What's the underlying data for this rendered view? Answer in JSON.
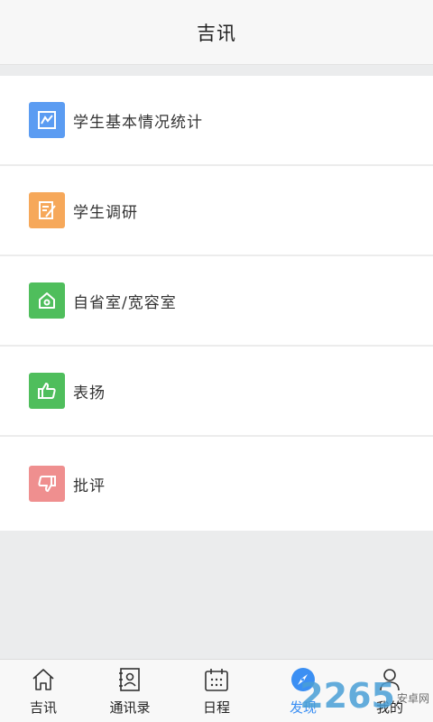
{
  "header": {
    "title": "吉讯"
  },
  "menu": {
    "items": [
      {
        "label": "学生基本情况统计",
        "icon": "chart-icon",
        "color": "#5b9cf2"
      },
      {
        "label": "学生调研",
        "icon": "survey-edit-icon",
        "color": "#f6a85a"
      },
      {
        "label": "自省室/宽容室",
        "icon": "house-icon",
        "color": "#4fbe5c"
      },
      {
        "label": "表扬",
        "icon": "thumbs-up-icon",
        "color": "#4fbe5c"
      },
      {
        "label": "批评",
        "icon": "thumbs-down-icon",
        "color": "#ef8f8f"
      }
    ]
  },
  "tabbar": {
    "tabs": [
      {
        "label": "吉讯",
        "icon": "home-icon"
      },
      {
        "label": "通讯录",
        "icon": "contacts-icon"
      },
      {
        "label": "日程",
        "icon": "calendar-icon"
      },
      {
        "label": "发现",
        "icon": "compass-icon",
        "active": true
      },
      {
        "label": "我的",
        "icon": "person-icon"
      }
    ],
    "active_color": "#3b8ff3"
  },
  "watermark": {
    "number": "2265",
    "text": "安卓网"
  }
}
